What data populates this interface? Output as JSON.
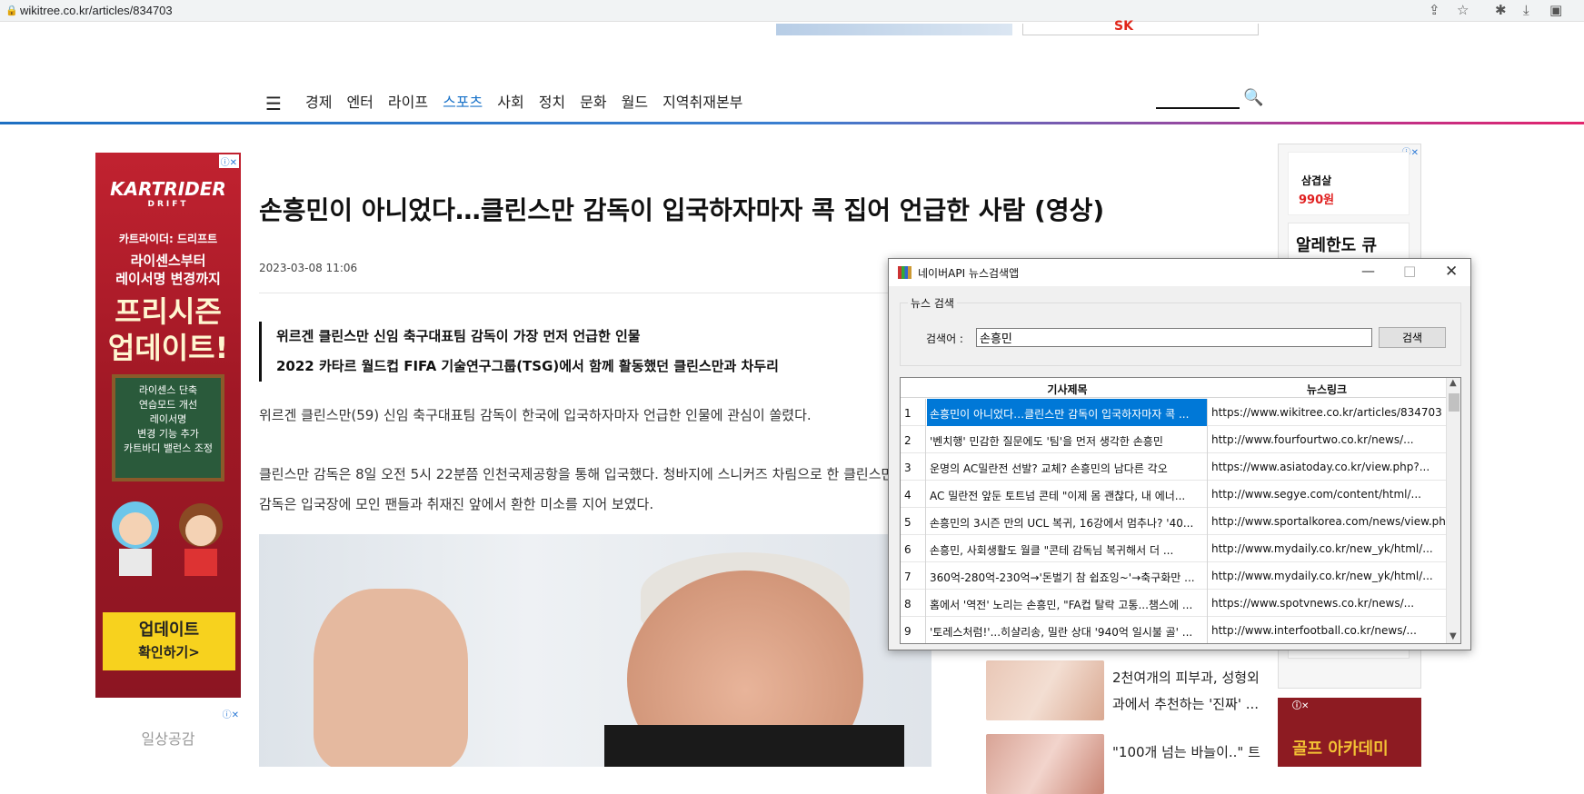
{
  "browser": {
    "url": "wikitree.co.kr/articles/834703"
  },
  "ads": {
    "top_logo": "SK",
    "left_brand": "KARTRIDER",
    "left_sub": "DRIFT",
    "left_line1": "카트라이더: 드리프트",
    "left_line2": "라이센스부터",
    "left_line3": "레이서명 변경까지",
    "left_line4": "프리시즌",
    "left_line5": "업데이트!",
    "left_board": [
      "라이센스 단축",
      "연습모드 개선",
      "레이서명",
      "변경 기능 추가",
      "카트바디 밸런스 조정"
    ],
    "left_btn1": "업데이트",
    "left_btn2": "확인하기>",
    "left2_text": "일상공감",
    "right_price": "990원",
    "right_item": "삼겹살",
    "right_box": "알레한도 큐",
    "right2_text": "골프 아카데미"
  },
  "nav": {
    "items": [
      {
        "label": "경제"
      },
      {
        "label": "엔터"
      },
      {
        "label": "라이프"
      },
      {
        "label": "스포츠",
        "active": true
      },
      {
        "label": "사회"
      },
      {
        "label": "정치"
      },
      {
        "label": "문화"
      },
      {
        "label": "월드"
      },
      {
        "label": "지역취재본부"
      }
    ]
  },
  "article": {
    "title": "손흥민이 아니었다…클린스만 감독이 입국하자마자 콕 집어 언급한 사람 (영상)",
    "date": "2023-03-08 11:06",
    "summary1": "위르겐 클린스만 신임 축구대표팀 감독이 가장 먼저 언급한 인물",
    "summary2": "2022 카타르 월드컵 FIFA 기술연구그룹(TSG)에서 함께 활동했던 클린스만과 차두리",
    "body1": "위르겐 클린스만(59) 신임 축구대표팀 감독이 한국에 입국하자마자 언급한 인물에 관심이 쏠렸다.",
    "body2": "클린스만 감독은 8일 오전 5시 22분쯤 인천국제공항을 통해 입국했다. 청바지에 스니커즈 차림으로 한 클린스만 감독은 입국장에 모인 팬들과 취재진 앞에서 환한 미소를 지어 보였다."
  },
  "recommend": [
    {
      "text": "2천여개의 피부과, 성형외과에서 추천하는 '진짜' ..."
    },
    {
      "text": "\"100개 넘는 바늘이..\" 트"
    }
  ],
  "app": {
    "title": "네이버API 뉴스검색앱",
    "group_label": "뉴스 검색",
    "keyword_label": "검색어 :",
    "keyword_value": "손흥민",
    "search_button": "검색",
    "columns": [
      "기사제목",
      "뉴스링크"
    ],
    "rows": [
      {
        "n": "1",
        "title": "손흥민이 아니었다…클린스만 감독이 입국하자마자 콕 ...",
        "link": "https://www.wikitree.co.kr/articles/834703"
      },
      {
        "n": "2",
        "title": "'벤치행' 민감한 질문에도 '팀'을 먼저 생각한 손흥민",
        "link": "http://www.fourfourtwo.co.kr/news/..."
      },
      {
        "n": "3",
        "title": "운명의 AC밀란전 선발? 교체? 손흥민의 남다른 각오",
        "link": "https://www.asiatoday.co.kr/view.php?..."
      },
      {
        "n": "4",
        "title": "AC 밀란전 앞둔 토트넘 콘테 \"이제 몸 괜찮다, 내 에너...",
        "link": "http://www.segye.com/content/html/..."
      },
      {
        "n": "5",
        "title": "손흥민의 3시즌 만의 UCL 복귀, 16강에서 멈추나? '40...",
        "link": "http://www.sportalkorea.com/news/view.php..."
      },
      {
        "n": "6",
        "title": "손흥민, 사회생활도 월클 \"콘테 감독님 복귀해서 더 ...",
        "link": "http://www.mydaily.co.kr/new_yk/html/..."
      },
      {
        "n": "7",
        "title": "360억-280억-230억→'돈벌기 참 쉽죠잉~'→축구화만 ...",
        "link": "http://www.mydaily.co.kr/new_yk/html/..."
      },
      {
        "n": "8",
        "title": "홈에서 '역전' 노리는 손흥민, \"FA컵 탈락 고통...챔스에 ...",
        "link": "https://www.spotvnews.co.kr/news/..."
      },
      {
        "n": "9",
        "title": "'토레스처럼!'...히샬리송, 밀란 상대 '940억 일시불 골' ...",
        "link": "http://www.interfootball.co.kr/news/..."
      }
    ]
  }
}
